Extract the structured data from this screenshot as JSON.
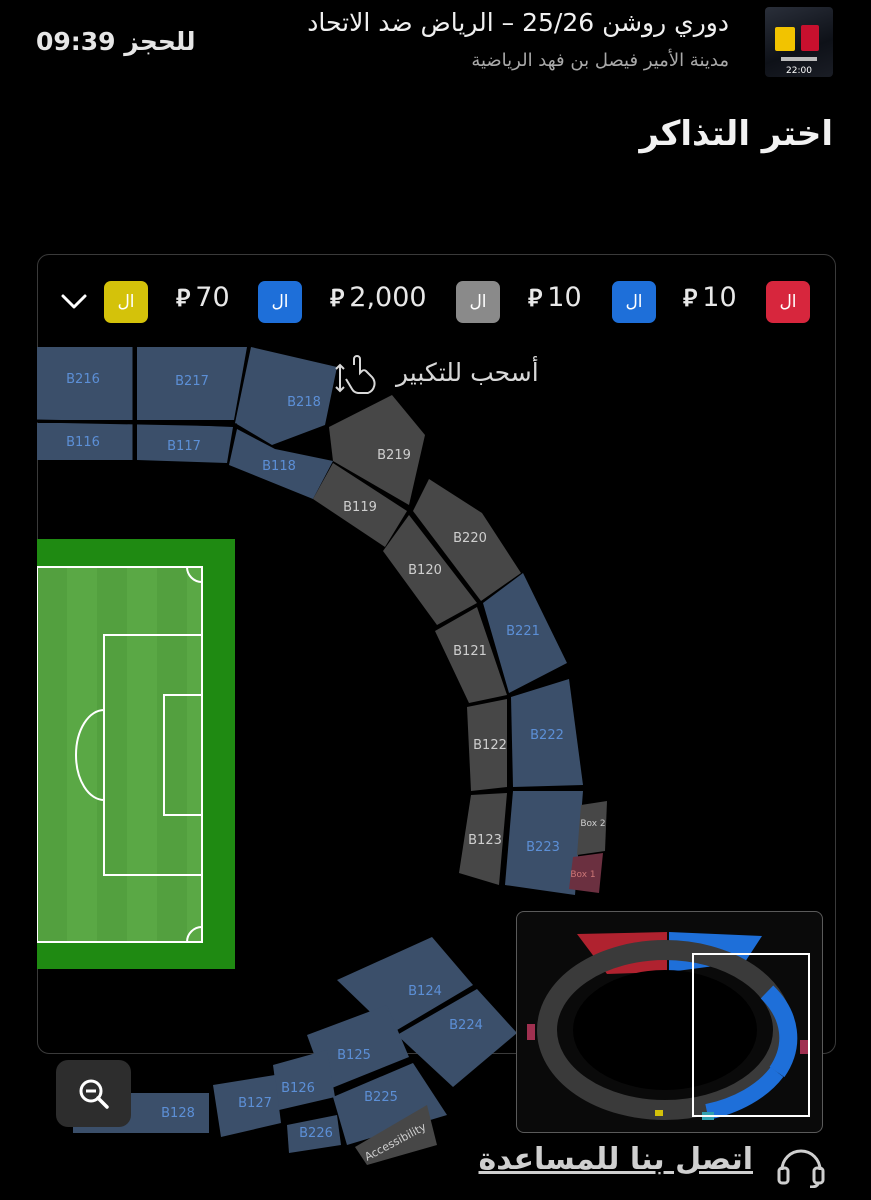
{
  "header": {
    "timer": "09:39 للحجز",
    "event_title": "دوري روشن 25/26 – الرياض ضد الاتحاد",
    "venue": "مدينة الأمير فيصل بن فهد الرياضية",
    "thumb_time": "22:00"
  },
  "page_title": "اختر التذاكر",
  "price_legend": [
    {
      "label": "ال",
      "price": "10",
      "color": "#d7263d"
    },
    {
      "label": "ال",
      "price": "10",
      "color": "#1e6fd9"
    },
    {
      "label": "ال",
      "price": "2,000",
      "color": "#8a8a8a"
    },
    {
      "label": "ال",
      "price": "70",
      "color": "#1e6fd9"
    },
    {
      "label": "ال",
      "price": "",
      "color": "#d4c20a"
    }
  ],
  "currency_symbol": "⃁",
  "drag_hint": "أسحب للتكبير",
  "sections": {
    "B216": "B216",
    "B217": "B217",
    "B218": "B218",
    "B116": "B116",
    "B117": "B117",
    "B118": "B118",
    "B219": "B219",
    "B119": "B119",
    "B220": "B220",
    "B120": "B120",
    "B221": "B221",
    "B121": "B121",
    "B222": "B222",
    "B122": "B122",
    "B223": "B223",
    "B123": "B123",
    "Box2": "Box 2",
    "Box1": "Box 1",
    "B124": "B124",
    "B224": "B224",
    "B125": "B125",
    "B126": "B126",
    "B225": "B225",
    "B127": "B127",
    "B128": "B128",
    "B226": "B226",
    "Accessibility": "Accessibility"
  },
  "help_link": "اتصل بنا للمساعدة",
  "colors": {
    "available_blue": "#3b4f6a",
    "unavailable_gray": "#474747",
    "pitch_green": "#5aa845",
    "pitch_border": "#1f8a12"
  }
}
